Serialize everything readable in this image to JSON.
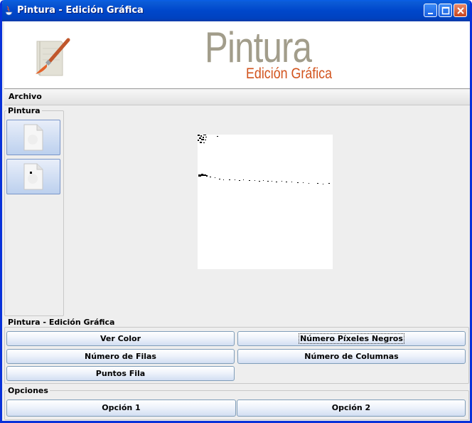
{
  "window": {
    "title": "Pintura - Edición Gráfica"
  },
  "banner": {
    "logo_title": "Pintura",
    "logo_subtitle": "Edición Gráfica",
    "title_color": "#a29d8b",
    "subtitle_color": "#d2541e"
  },
  "menu": {
    "items": [
      "Archivo"
    ]
  },
  "tools_panel": {
    "title": "Pintura",
    "tools": [
      {
        "icon": "blank-page-icon"
      },
      {
        "icon": "page-with-dot-icon"
      }
    ]
  },
  "actions_panel": {
    "title": "Pintura - Edición Gráfica",
    "buttons": {
      "ver_color": "Ver Color",
      "num_pixeles_negros": "Número Píxeles Negros",
      "num_filas": "Número de Filas",
      "num_columnas": "Número de Columnas",
      "puntos_fila": "Puntos Fila"
    }
  },
  "options_panel": {
    "title": "Opciones",
    "buttons": {
      "opcion1": "Opción 1",
      "opcion2": "Opción 2"
    }
  }
}
